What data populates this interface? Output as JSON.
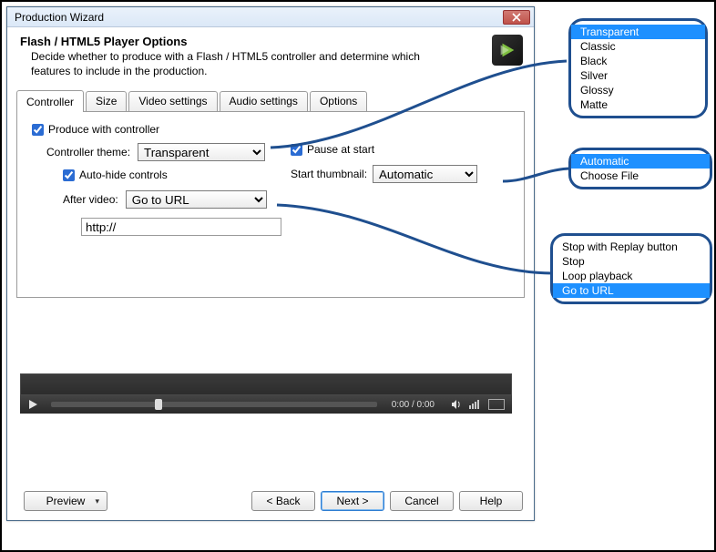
{
  "window": {
    "title": "Production Wizard"
  },
  "header": {
    "title": "Flash / HTML5 Player Options",
    "desc": "Decide whether to produce with a Flash / HTML5 controller and determine which features to include in the production."
  },
  "tabs": {
    "controller": "Controller",
    "size": "Size",
    "video": "Video settings",
    "audio": "Audio settings",
    "options": "Options"
  },
  "form": {
    "produce_with_controller": "Produce with controller",
    "controller_theme_label": "Controller theme:",
    "controller_theme_value": "Transparent",
    "auto_hide": "Auto-hide controls",
    "after_video_label": "After video:",
    "after_video_value": "Go to URL",
    "url_value": "http://",
    "pause_at_start": "Pause at start",
    "start_thumb_label": "Start thumbnail:",
    "start_thumb_value": "Automatic"
  },
  "video": {
    "time": "0:00  /  0:00"
  },
  "buttons": {
    "preview": "Preview",
    "back": "< Back",
    "next": "Next >",
    "cancel": "Cancel",
    "help": "Help"
  },
  "callouts": {
    "themes": {
      "opt1": "Transparent",
      "opt2": "Classic",
      "opt3": "Black",
      "opt4": "Silver",
      "opt5": "Glossy",
      "opt6": "Matte"
    },
    "thumbs": {
      "opt1": "Automatic",
      "opt2": "Choose File"
    },
    "after": {
      "opt1": "Stop with Replay button",
      "opt2": "Stop",
      "opt3": "Loop playback",
      "opt4": "Go to URL"
    }
  }
}
